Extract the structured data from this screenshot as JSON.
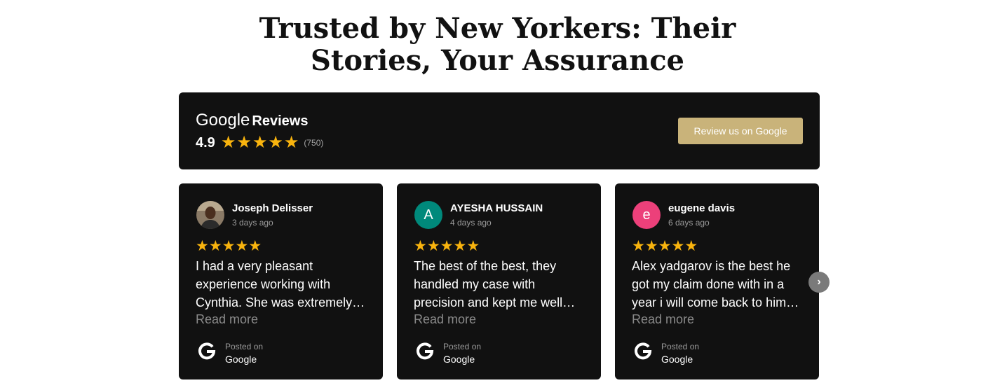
{
  "headline": {
    "line1": "Trusted by New Yorkers: Their",
    "line2": "Stories, Your Assurance"
  },
  "summary": {
    "brand": "Google",
    "label": "Reviews",
    "rating": "4.9",
    "stars": 5,
    "count": "(750)",
    "button_label": "Review us on Google"
  },
  "reviews": [
    {
      "name": "Joseph Delisser",
      "date": "3 days ago",
      "stars": 5,
      "text": "I had a very pleasant experience working with Cynthia. She was extremely…",
      "read_more": "Read more",
      "posted_on": "Posted on",
      "platform": "Google",
      "avatar_type": "photo"
    },
    {
      "name": "AYESHA HUSSAIN",
      "date": "4 days ago",
      "stars": 5,
      "text": "The best of the best, they handled my case with precision and kept me well…",
      "read_more": "Read more",
      "posted_on": "Posted on",
      "platform": "Google",
      "avatar_letter": "A",
      "avatar_color": "#00897b"
    },
    {
      "name": "eugene davis",
      "date": "6 days ago",
      "stars": 5,
      "text": "Alex yadgarov is the best he got my claim done with in a year i will come back to him…",
      "read_more": "Read more",
      "posted_on": "Posted on",
      "platform": "Google",
      "avatar_letter": "e",
      "avatar_color": "#ec407a"
    }
  ],
  "icons": {
    "star": "star-icon",
    "google": "google-g-icon",
    "next": "chevron-right-icon"
  },
  "colors": {
    "star": "#f9b40e",
    "button": "#c9b37a",
    "panel": "#111111"
  }
}
